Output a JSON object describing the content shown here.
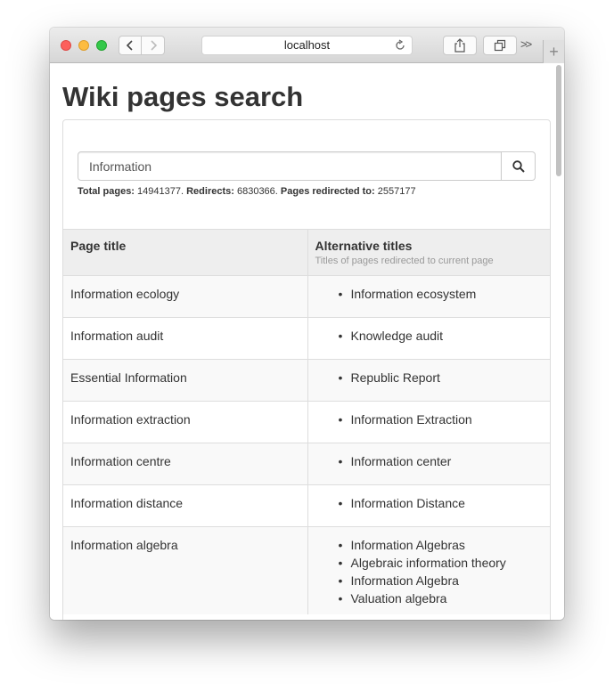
{
  "browser": {
    "url": "localhost",
    "back_icon": "chevron-left-icon",
    "forward_icon": "chevron-right-icon",
    "reload_icon": "reload-icon",
    "share_icon": "share-icon",
    "tabs_icon": "tabs-icon",
    "more_label": ">>",
    "new_tab_label": "+"
  },
  "page": {
    "title": "Wiki pages search"
  },
  "search": {
    "value": "Information",
    "button_icon": "search-icon"
  },
  "stats": {
    "total_label": "Total pages:",
    "total_value": "14941377.",
    "redirects_label": "Redirects:",
    "redirects_value": "6830366.",
    "redirected_to_label": "Pages redirected to:",
    "redirected_to_value": "2557177"
  },
  "table": {
    "col1_header": "Page title",
    "col2_header": "Alternative titles",
    "col2_subheader": "Titles of pages redirected to current page",
    "rows": [
      {
        "title": "Information ecology",
        "alternatives": [
          "Information ecosystem"
        ]
      },
      {
        "title": "Information audit",
        "alternatives": [
          "Knowledge audit"
        ]
      },
      {
        "title": "Essential Information",
        "alternatives": [
          "Republic Report"
        ]
      },
      {
        "title": "Information extraction",
        "alternatives": [
          "Information Extraction"
        ]
      },
      {
        "title": "Information centre",
        "alternatives": [
          "Information center"
        ]
      },
      {
        "title": "Information distance",
        "alternatives": [
          "Information Distance"
        ]
      },
      {
        "title": "Information algebra",
        "alternatives": [
          "Information Algebras",
          "Algebraic information theory",
          "Information Algebra",
          "Valuation algebra"
        ]
      }
    ]
  },
  "colors": {
    "close": "#fc605c",
    "minimize": "#fdbc40",
    "zoom": "#34c84a",
    "header_bg": "#eeeeee",
    "stripe_bg": "#f9f9f9"
  }
}
